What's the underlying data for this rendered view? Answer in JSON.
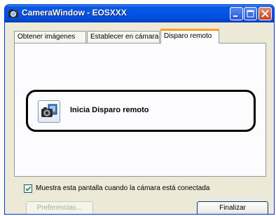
{
  "window": {
    "title": "CameraWindow - EOSXXX",
    "title_icon": "camera-icon"
  },
  "tabs": [
    {
      "label": "Obtener imágenes"
    },
    {
      "label": "Establecer en cámara"
    },
    {
      "label": "Disparo remoto",
      "selected": true
    }
  ],
  "main": {
    "action_label": "Inicia Disparo remoto",
    "action_icon": "remote-camera-icon"
  },
  "footer": {
    "checkbox_label": "Muestra esta pantalla cuando la cámara está conectada",
    "checkbox_checked": true,
    "preferences_label": "Preferencias...",
    "finish_label": "Finalizar"
  },
  "colors": {
    "titlebar": "#0554E8",
    "selected_tab_accent": "#FF9F1E",
    "highlight_border": "#000000"
  }
}
